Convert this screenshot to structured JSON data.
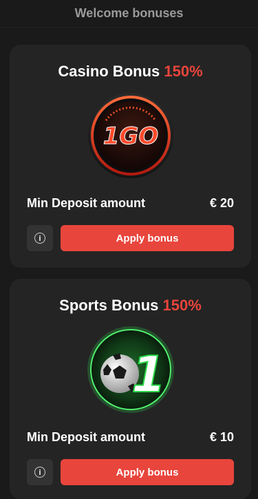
{
  "header": {
    "title": "Welcome bonuses"
  },
  "bonuses": [
    {
      "name": "Casino Bonus",
      "percent": "150%",
      "badge_text": "1GO",
      "deposit_label": "Min Deposit amount",
      "deposit_value": "€ 20",
      "apply_label": "Apply bonus",
      "info_glyph": "i"
    },
    {
      "name": "Sports Bonus",
      "percent": "150%",
      "badge_text": "1",
      "deposit_label": "Min Deposit amount",
      "deposit_value": "€ 10",
      "apply_label": "Apply bonus",
      "info_glyph": "i"
    }
  ],
  "colors": {
    "accent": "#e8453c",
    "background": "#1a1a1a",
    "card": "#242424",
    "sports_glow": "#2bd94a"
  },
  "icons": [
    "casino-badge-icon",
    "sports-badge-icon",
    "info-icon"
  ]
}
